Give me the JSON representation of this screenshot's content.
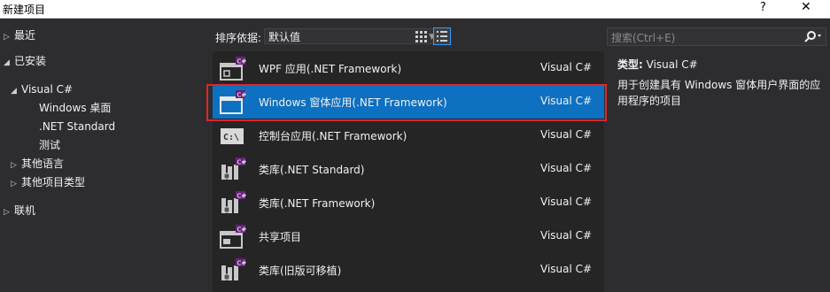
{
  "window": {
    "title": "新建项目",
    "help": "?",
    "close": "✕"
  },
  "tree": {
    "recent": "最近",
    "installed": "已安装",
    "visual_csharp": "Visual C#",
    "windows_desktop": "Windows 桌面",
    "net_standard": ".NET Standard",
    "test": "测试",
    "other_languages": "其他语言",
    "other_project_types": "其他项目类型",
    "online": "联机"
  },
  "toolbar": {
    "sort_label": "排序依据:",
    "sort_value": "默认值"
  },
  "templates": [
    {
      "name": "WPF 应用(.NET Framework)",
      "lang": "Visual C#",
      "icon": "wpf-app-icon"
    },
    {
      "name": "Windows 窗体应用(.NET Framework)",
      "lang": "Visual C#",
      "icon": "windows-forms-app-icon"
    },
    {
      "name": "控制台应用(.NET Framework)",
      "lang": "Visual C#",
      "icon": "console-app-icon"
    },
    {
      "name": "类库(.NET Standard)",
      "lang": "Visual C#",
      "icon": "class-library-icon"
    },
    {
      "name": "类库(.NET Framework)",
      "lang": "Visual C#",
      "icon": "class-library-icon"
    },
    {
      "name": "共享项目",
      "lang": "Visual C#",
      "icon": "shared-project-icon"
    },
    {
      "name": "类库(旧版可移植)",
      "lang": "Visual C#",
      "icon": "class-library-icon"
    }
  ],
  "search": {
    "placeholder": "搜索(Ctrl+E)"
  },
  "detail": {
    "type_key": "类型:",
    "type_value": "Visual C#",
    "description": "用于创建具有 Windows 窗体用户界面的应用程序的项目"
  },
  "colors": {
    "selection": "#0e70c0",
    "highlight_border": "#e0262a",
    "background": "#2d2d30",
    "list_background": "#252526"
  }
}
